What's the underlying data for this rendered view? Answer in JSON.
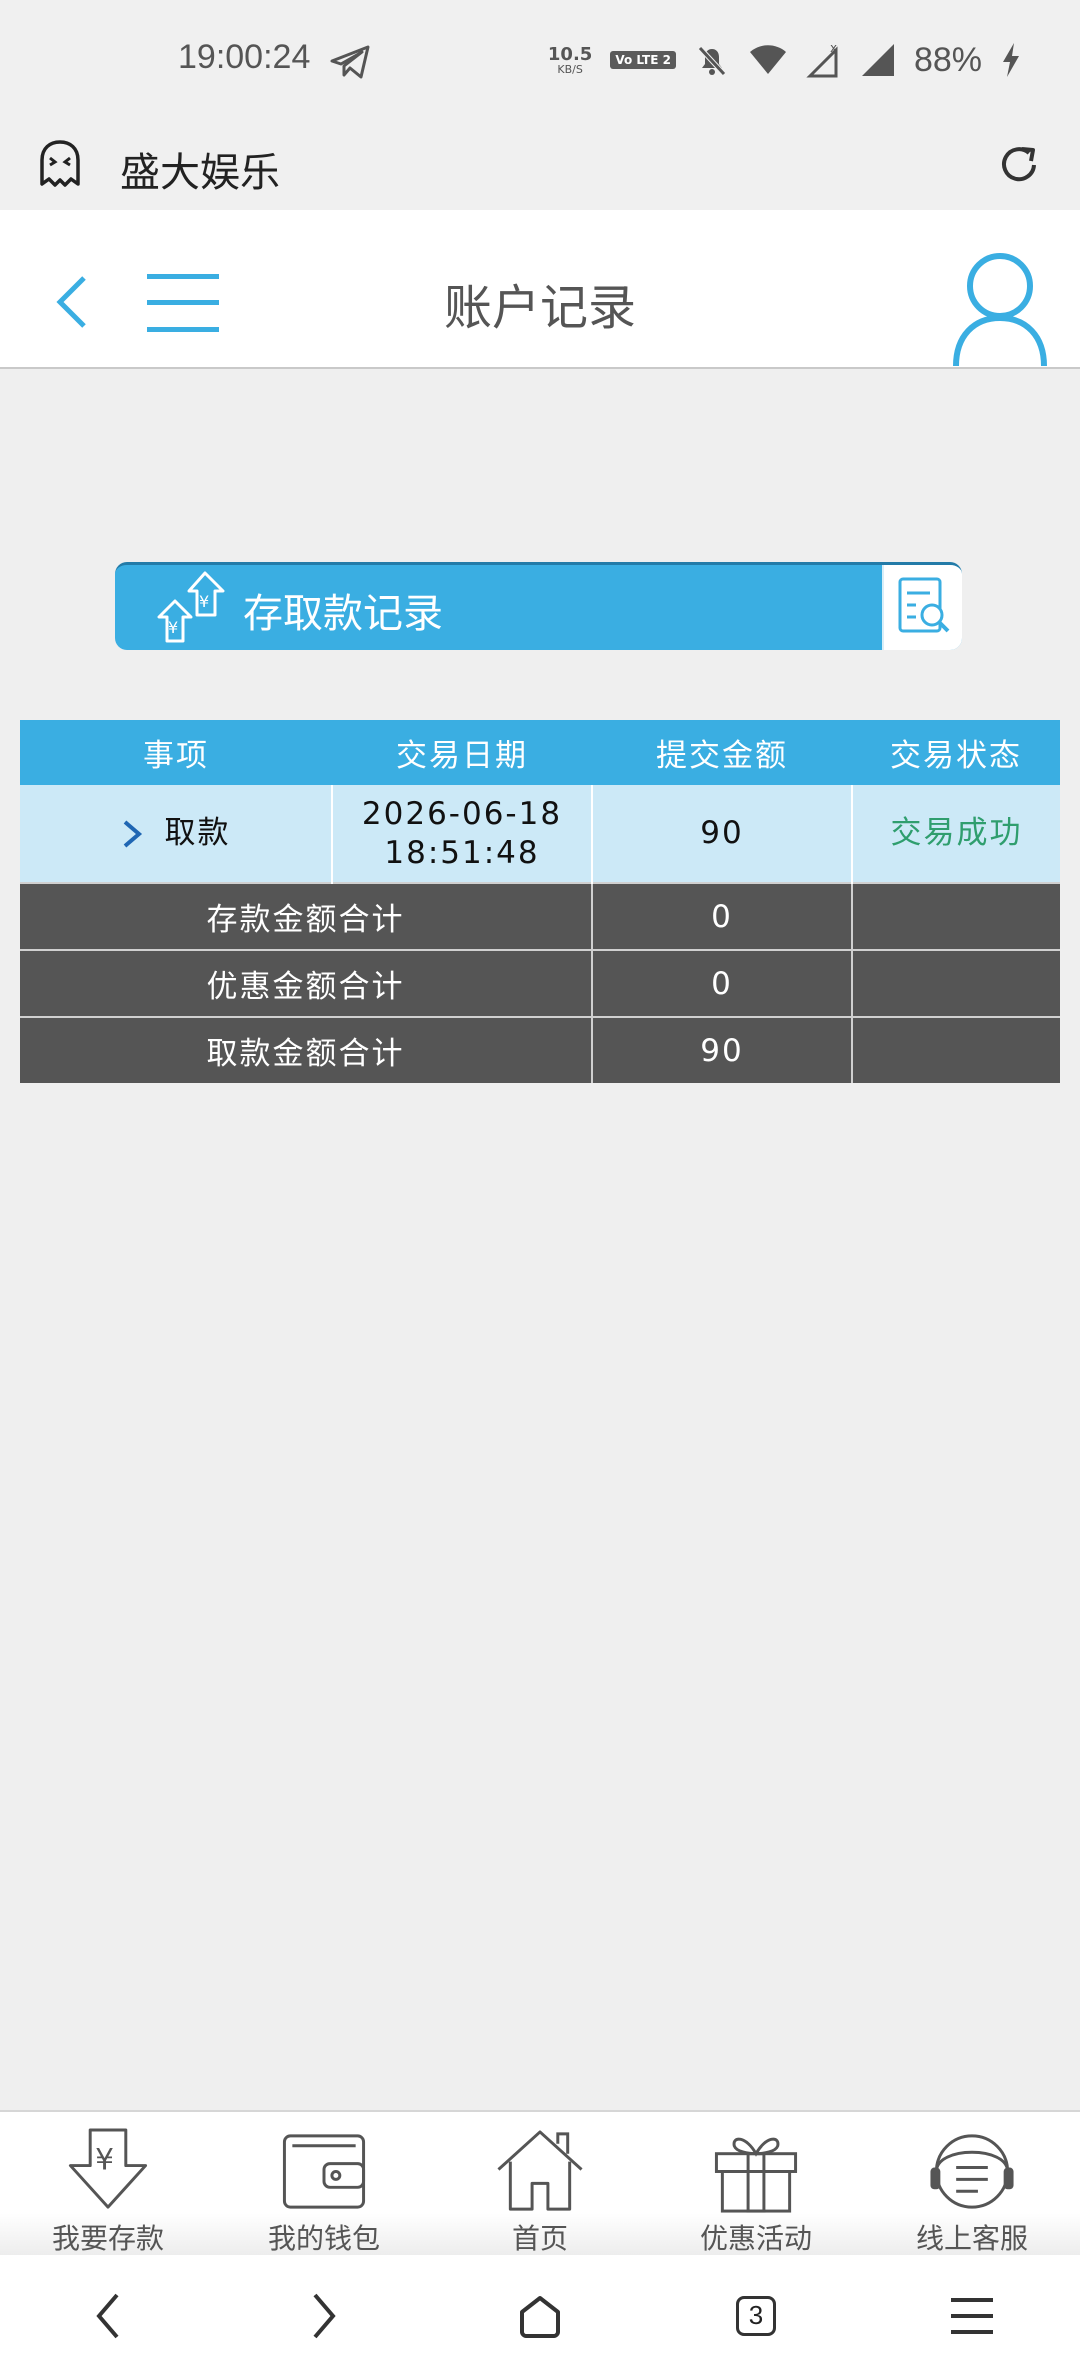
{
  "status_bar": {
    "time": "19:00:24",
    "net_speed_value": "10.5",
    "net_speed_unit": "KB/S",
    "volte_label": "Vo LTE 2",
    "battery": "88%"
  },
  "app_bar": {
    "title": "盛大娱乐"
  },
  "header": {
    "title": "账户记录"
  },
  "banner": {
    "label": "存取款记录"
  },
  "table": {
    "columns": [
      "事项",
      "交易日期",
      "提交金额",
      "交易状态"
    ],
    "rows": [
      {
        "item": "取款",
        "date": "2026-06-18",
        "time": "18:51:48",
        "amount": "90",
        "status": "交易成功"
      }
    ],
    "summary": [
      {
        "label": "存款金额合计",
        "value": "0"
      },
      {
        "label": "优惠金额合计",
        "value": "0"
      },
      {
        "label": "取款金额合计",
        "value": "90"
      }
    ]
  },
  "tab_bar": {
    "items": [
      {
        "label": "我要存款",
        "icon": "deposit-icon"
      },
      {
        "label": "我的钱包",
        "icon": "wallet-icon"
      },
      {
        "label": "首页",
        "icon": "home-icon"
      },
      {
        "label": "优惠活动",
        "icon": "gift-icon"
      },
      {
        "label": "线上客服",
        "icon": "support-icon"
      }
    ]
  },
  "nav_bar": {
    "tabs_count": "3"
  },
  "colors": {
    "accent": "#3aaee2",
    "row_highlight": "#cce9f7",
    "summary_bg": "#555555",
    "success": "#2f9e6e"
  }
}
